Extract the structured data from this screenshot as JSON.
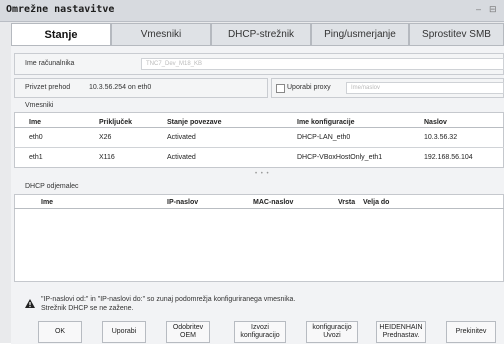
{
  "window": {
    "title": "Omrežne nastavitve",
    "minimize_glyph": "–",
    "restore_glyph": "⊟"
  },
  "tabs": [
    {
      "label": "Stanje"
    },
    {
      "label": "Vmesniki"
    },
    {
      "label": "DHCP-strežnik"
    },
    {
      "label": "Ping/usmerjanje"
    },
    {
      "label": "Sprostitev SMB"
    }
  ],
  "computer": {
    "label": "Ime računalnika",
    "value": "TNC7_Dev_M18_KB"
  },
  "gateway": {
    "label": "Privzet prehod",
    "value": "10.3.56.254 on eth0"
  },
  "proxy": {
    "label": "Uporabi proxy",
    "placeholder": "Ime/naslov"
  },
  "interfaces": {
    "section_label": "Vmesniki",
    "columns": [
      "Ime",
      "Priključek",
      "Stanje povezave",
      "Ime konfiguracije",
      "Naslov"
    ],
    "rows": [
      [
        "eth0",
        "X26",
        "Activated",
        "DHCP-LAN_eth0",
        "10.3.56.32"
      ],
      [
        "eth1",
        "X116",
        "Activated",
        "DHCP-VBoxHostOnly_eth1",
        "192.168.56.104"
      ]
    ]
  },
  "splitter": "• • •",
  "dhcp": {
    "section_label": "DHCP odjemalec",
    "columns": [
      "Ime",
      "IP-naslov",
      "MAC-naslov",
      "Vrsta",
      "Velja do"
    ]
  },
  "warning": {
    "icon": "warning-icon",
    "line1": "\"IP-naslovi od:\" in \"IP-naslovi do:\" so zunaj podomrežja konfiguriranega vmesnika.",
    "line2": "Strežnik DHCP se ne zažene."
  },
  "buttons": {
    "ok": "OK",
    "apply": "Uporabi",
    "unlock_oem": "Odobritev\nOEM",
    "export_config": "Izvozi\nkonfiguracijo",
    "import_config": "konfiguracijo\nUvozi",
    "heidenhain_default": "HEIDENHAIN\nPrednastav.",
    "cancel": "Prekinitev"
  }
}
